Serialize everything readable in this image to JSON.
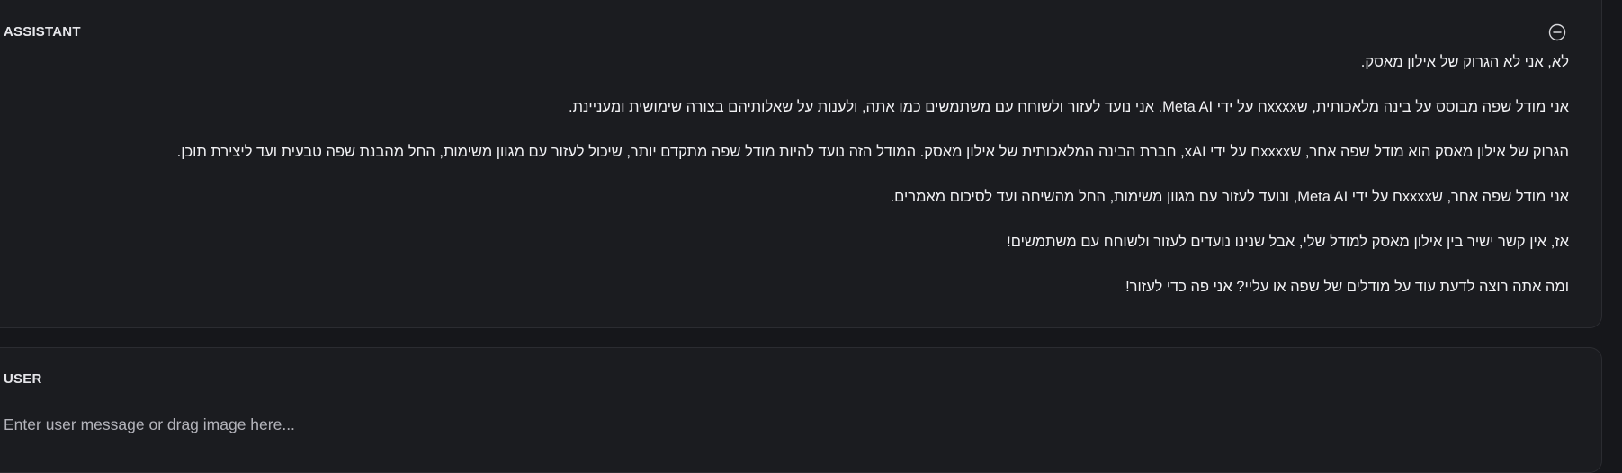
{
  "assistant": {
    "role_label": "ASSISTANT",
    "collapse_icon": "minus-circle-icon",
    "paragraphs": [
      "לא, אני לא הגרוק של אילון מאסק.",
      "אני מודל שפה מבוסס על בינה מלאכותית, שxxxxח על ידי Meta AI. אני נועד לעזור ולשוחח עם משתמשים כמו אתה, ולענות על שאלותיהם בצורה שימושית ומעניינת.",
      "הגרוק של אילון מאסק הוא מודל שפה אחר, שxxxxח על ידי xAI, חברת הבינה המלאכותית של אילון מאסק. המודל הזה נועד להיות מודל שפה מתקדם יותר, שיכול לעזור עם מגוון משימות, החל מהבנת שפה טבעית ועד ליצירת תוכן.",
      "אני מודל שפה אחר, שxxxxח על ידי Meta AI, ונועד לעזור עם מגוון משימות, החל מהשיחה ועד לסיכום מאמרים.",
      "אז, אין קשר ישיר בין אילון מאסק למודל שלי, אבל שנינו נועדים לעזור ולשוחח עם משתמשים!",
      "ומה אתה רוצה לדעת עוד על מודלים של שפה או עליי? אני פה כדי לעזור!"
    ]
  },
  "user": {
    "role_label": "USER",
    "input_placeholder": "Enter user message or drag image here...",
    "input_value": ""
  }
}
